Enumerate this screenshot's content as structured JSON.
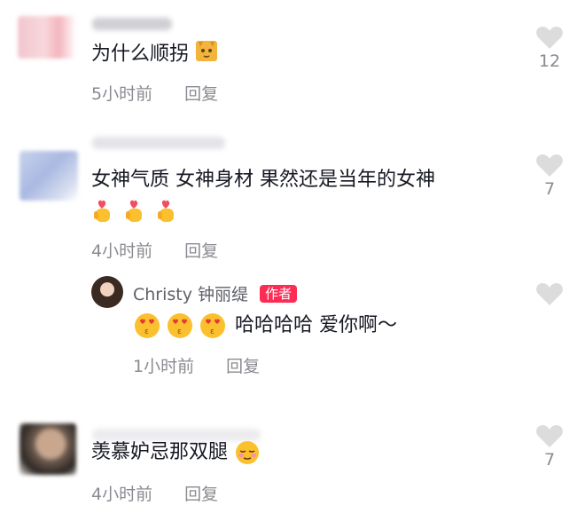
{
  "comments": [
    {
      "text": "为什么顺拐",
      "time": "5小时前",
      "reply_label": "回复",
      "like_count": "12",
      "emoji": "cat-face-emoji"
    },
    {
      "text": "女神气质 女神身材 果然还是当年的女神",
      "time": "4小时前",
      "reply_label": "回复",
      "like_count": "7",
      "emoji": "finger-heart-emoji"
    },
    {
      "author": "Christy 钟丽缇",
      "author_badge": "作者",
      "text": "哈哈哈哈 爱你啊～",
      "time": "1小时前",
      "reply_label": "回复",
      "emoji": "heart-eyes-kiss-emoji"
    },
    {
      "text": "羡慕妒忌那双腿",
      "time": "4小时前",
      "reply_label": "回复",
      "like_count": "7",
      "emoji": "relieved-face-emoji"
    }
  ],
  "colors": {
    "accent_badge": "#fe2c55",
    "meta_text": "#8a8b91",
    "heart_outline": "#d9d9d9"
  }
}
